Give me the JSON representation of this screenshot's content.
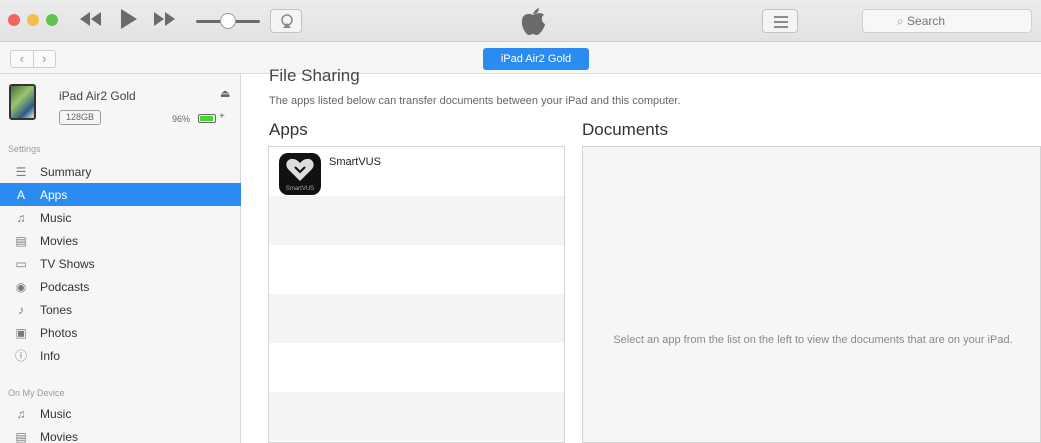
{
  "window": {
    "apple_logo": "apple-icon",
    "search_placeholder": "Search"
  },
  "nav": {
    "back": "‹",
    "forward": "›",
    "device_pill": "iPad Air2 Gold"
  },
  "device": {
    "name": "iPad Air2 Gold",
    "capacity": "128GB",
    "battery_percent": "96%",
    "battery_level": 0.96
  },
  "sidebar": {
    "settings_header": "Settings",
    "settings_items": [
      {
        "label": "Summary",
        "icon": "summary-icon"
      },
      {
        "label": "Apps",
        "icon": "apps-icon",
        "active": true
      },
      {
        "label": "Music",
        "icon": "music-icon"
      },
      {
        "label": "Movies",
        "icon": "movies-icon"
      },
      {
        "label": "TV Shows",
        "icon": "tv-shows-icon"
      },
      {
        "label": "Podcasts",
        "icon": "podcasts-icon"
      },
      {
        "label": "Tones",
        "icon": "tones-icon"
      },
      {
        "label": "Photos",
        "icon": "photos-icon"
      },
      {
        "label": "Info",
        "icon": "info-icon"
      }
    ],
    "device_header": "On My Device",
    "device_items": [
      {
        "label": "Music",
        "icon": "music-icon"
      },
      {
        "label": "Movies",
        "icon": "movies-icon"
      }
    ]
  },
  "main": {
    "heading": "File Sharing",
    "description": "The apps listed below can transfer documents between your iPad and this computer.",
    "apps_header": "Apps",
    "documents_header": "Documents",
    "apps": [
      {
        "name": "SmartVUS",
        "icon_caption": "SmartVUS"
      }
    ],
    "documents_placeholder": "Select an app from the list on the left to view the documents that are on your iPad."
  },
  "colors": {
    "accent": "#2a8cf1",
    "battery": "#4cd137"
  }
}
